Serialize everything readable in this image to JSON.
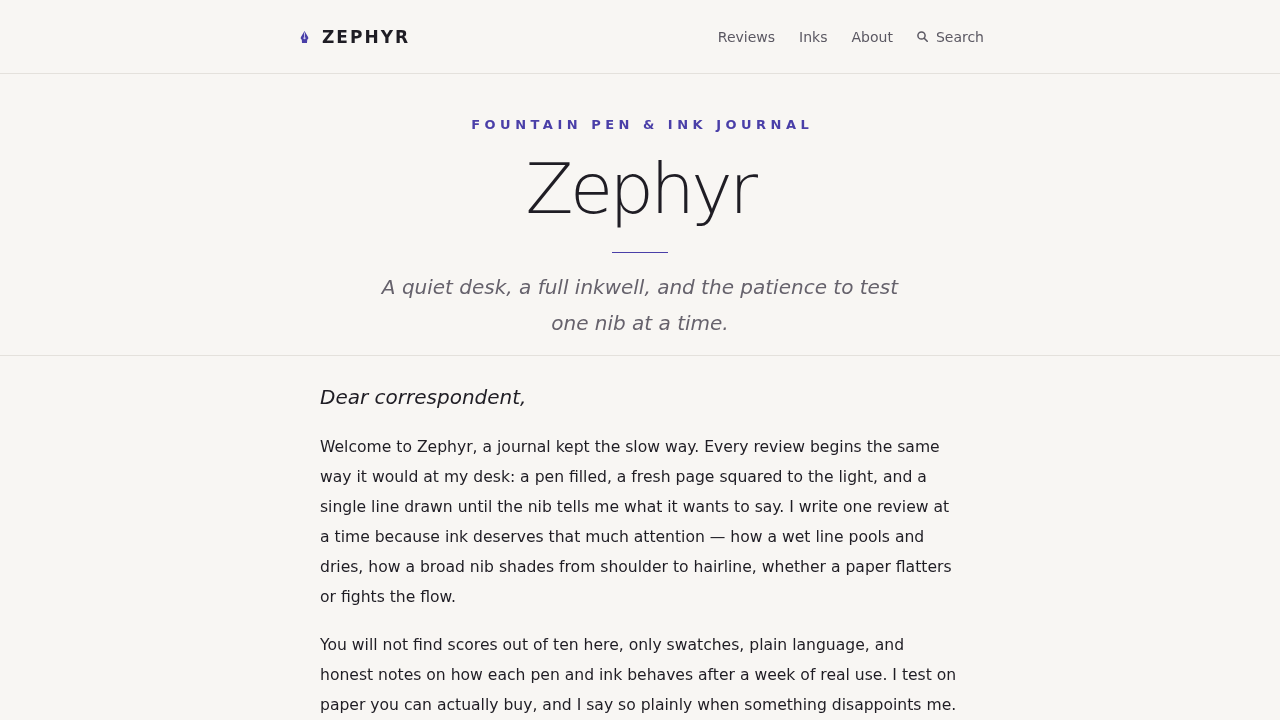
{
  "header": {
    "logo": "ZEPHYR",
    "nav": [
      {
        "label": "Reviews"
      },
      {
        "label": "Inks"
      },
      {
        "label": "About"
      }
    ],
    "search": {
      "label": "Search"
    }
  },
  "hero": {
    "eyebrow": "FOUNTAIN PEN & INK JOURNAL",
    "title": "Zephyr",
    "tagline": "A quiet desk, a full inkwell, and the patience to test one nib at a time."
  },
  "letter": {
    "salutation": "Dear correspondent,",
    "paragraphs": [
      "Welcome to Zephyr, a journal kept the slow way. Every review begins the same way it would at my desk: a pen filled, a fresh page squared to the light, and a single line drawn until the nib tells me what it wants to say. I write one review at a time because ink deserves that much attention — how a wet line pools and dries, how a broad nib shades from shoulder to hairline, whether a paper flatters or fights the flow.",
      "You will not find scores out of ten here, only swatches, plain language, and honest notes on how each pen and ink behaves after a week of real use. I test on paper you can actually buy, and I say so plainly when something disappoints me."
    ]
  }
}
